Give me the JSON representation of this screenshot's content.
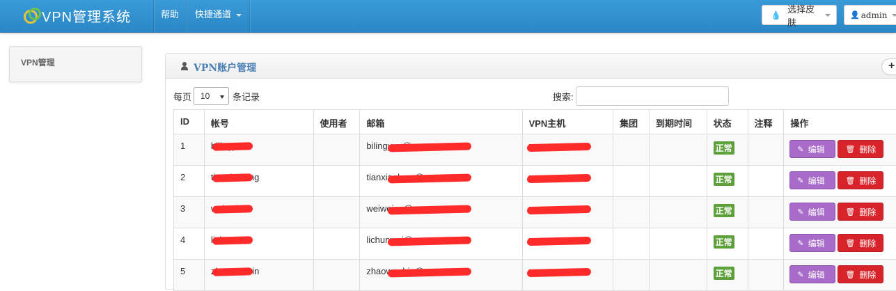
{
  "navbar": {
    "brand": "VPN管理系统",
    "help": "帮助",
    "quick_access": "快捷通道",
    "skin_button": "选择皮肤",
    "user_button": "admin"
  },
  "sidebar": {
    "items": [
      {
        "label": "VPN管理"
      }
    ]
  },
  "panel": {
    "title": "VPN账户管理",
    "add_icon": "plus-icon"
  },
  "table_controls": {
    "per_page_label": "每页",
    "page_size": "10",
    "records_label": "条记录",
    "search_label": "搜索:",
    "search_value": ""
  },
  "table": {
    "headers": [
      "ID",
      "帐号",
      "使用者",
      "邮箱",
      "VPN主机",
      "集团",
      "到期时间",
      "状态",
      "注释",
      "操作"
    ],
    "rows": [
      {
        "id": "1",
        "account": "bilingyun",
        "user": "",
        "email": "bilingyun@",
        "host": "vpn.",
        "group": "",
        "expires": "",
        "status": "正常",
        "note": ""
      },
      {
        "id": "2",
        "account": "tianxiaolong",
        "user": "",
        "email": "tianxiaolong@",
        "host": "vpn.",
        "group": "",
        "expires": "",
        "status": "正常",
        "note": ""
      },
      {
        "id": "3",
        "account": "weiweian",
        "user": "",
        "email": "weiweian@",
        "host": "vpn.",
        "group": "",
        "expires": "",
        "status": "正常",
        "note": ""
      },
      {
        "id": "4",
        "account": "lichunwei",
        "user": "",
        "email": "lichunwei@",
        "host": "vpn.",
        "group": "",
        "expires": "",
        "status": "正常",
        "note": ""
      },
      {
        "id": "5",
        "account": "zhaowenbin",
        "user": "",
        "email": "zhaowenbin@",
        "host": "vpn.",
        "group": "",
        "expires": "",
        "status": "正常",
        "note": ""
      }
    ],
    "edit_label": "编辑",
    "delete_label": "删除"
  },
  "colors": {
    "navbar": "#2b87c6",
    "status_ok": "#5ea03a",
    "edit_button": "#a86bc9",
    "delete_button": "#d9232b",
    "redaction": "#ff2a2a"
  }
}
